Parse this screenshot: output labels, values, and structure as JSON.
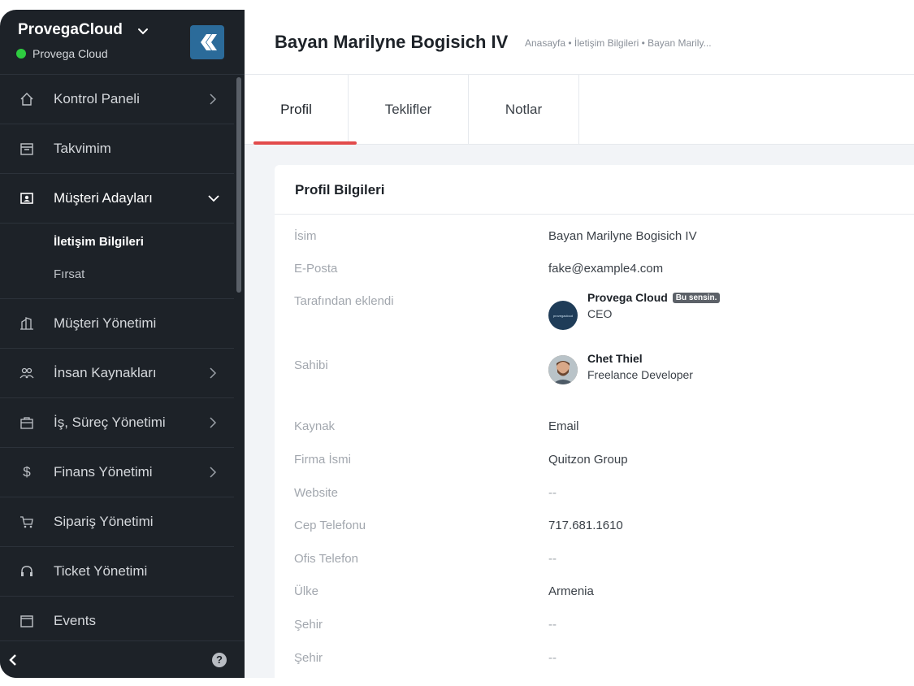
{
  "sidebar": {
    "brand_name": "ProvegaCloud",
    "brand_sub": "Provega Cloud",
    "items": [
      {
        "label": "Kontrol Paneli"
      },
      {
        "label": "Takvimim"
      },
      {
        "label": "Müşteri Adayları"
      },
      {
        "label": "Müşteri Yönetimi"
      },
      {
        "label": "İnsan Kaynakları"
      },
      {
        "label": "İş, Süreç Yönetimi"
      },
      {
        "label": "Finans Yönetimi"
      },
      {
        "label": "Sipariş Yönetimi"
      },
      {
        "label": "Ticket Yönetimi"
      },
      {
        "label": "Events"
      }
    ],
    "sub_items": [
      {
        "label": "İletişim Bilgileri"
      },
      {
        "label": "Fırsat"
      }
    ],
    "help_symbol": "?"
  },
  "header": {
    "title": "Bayan Marilyne Bogisich IV",
    "breadcrumb": "Anasayfa • İletişim Bilgileri • Bayan Marily..."
  },
  "tabs": [
    {
      "label": "Profil"
    },
    {
      "label": "Teklifler"
    },
    {
      "label": "Notlar"
    }
  ],
  "card": {
    "title": "Profil Bilgileri",
    "fields": {
      "name": {
        "label": "İsim",
        "value": "Bayan Marilyne Bogisich IV"
      },
      "email": {
        "label": "E-Posta",
        "value": "fake@example4.com"
      },
      "added_by": {
        "label": "Tarafından eklendi",
        "name": "Provega Cloud",
        "badge": "Bu sensin.",
        "role": "CEO",
        "avatar_text": "provegacloud"
      },
      "owner": {
        "label": "Sahibi",
        "name": "Chet Thiel",
        "role": "Freelance Developer"
      },
      "source": {
        "label": "Kaynak",
        "value": "Email"
      },
      "company": {
        "label": "Firma İsmi",
        "value": "Quitzon Group"
      },
      "website": {
        "label": "Website",
        "value": "--"
      },
      "mobile": {
        "label": "Cep Telefonu",
        "value": "717.681.1610"
      },
      "office": {
        "label": "Ofis Telefon",
        "value": "--"
      },
      "country": {
        "label": "Ülke",
        "value": "Armenia"
      },
      "city1": {
        "label": "Şehir",
        "value": "--"
      },
      "city2": {
        "label": "Şehir",
        "value": "--"
      }
    }
  },
  "colors": {
    "sidebar_bg": "#1d2228",
    "accent_red": "#e24b4b",
    "status_green": "#2ecc40",
    "logo_blue": "#2b6b9a"
  },
  "icons": [
    "chevron-down-icon",
    "brand-logo-icon",
    "home-icon",
    "calendar-icon",
    "contact-card-icon",
    "building-icon",
    "people-icon",
    "briefcase-icon",
    "dollar-icon",
    "cart-icon",
    "headset-icon",
    "event-icon",
    "chevron-right-icon",
    "chevron-left-icon",
    "help-icon"
  ]
}
